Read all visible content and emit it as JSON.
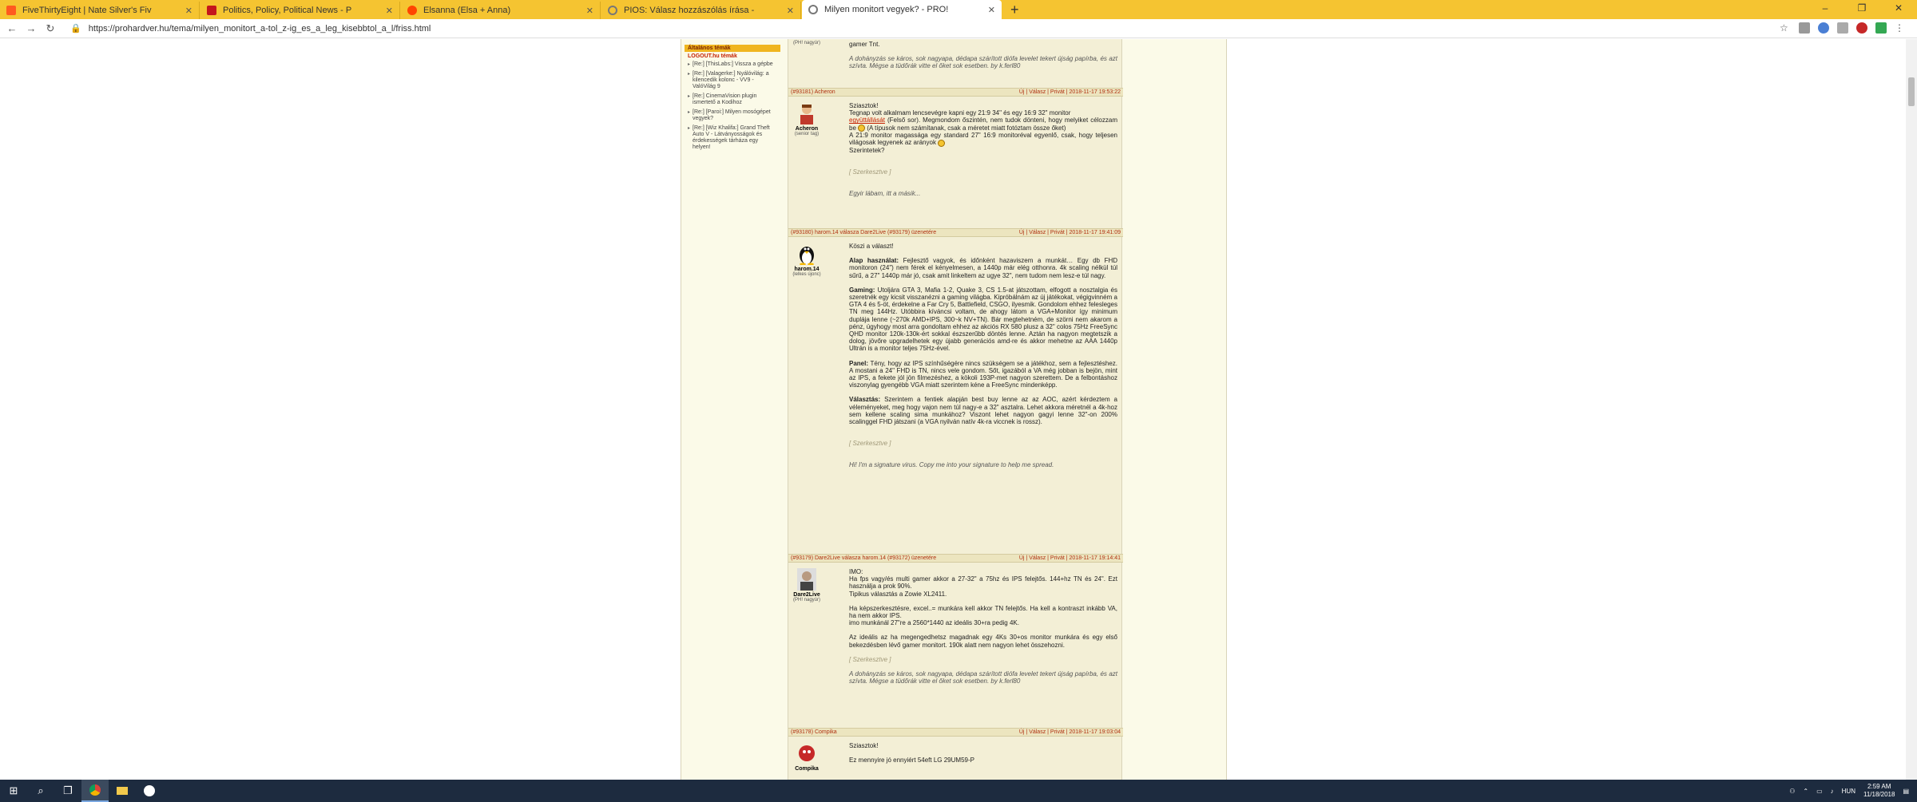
{
  "browser": {
    "tabs": [
      {
        "title": "FiveThirtyEight | Nate Silver's Fiv",
        "icon": "fivethirtyeight-icon",
        "color": "#ff5a1f"
      },
      {
        "title": "Politics, Policy, Political News - P",
        "icon": "politico-icon",
        "color": "#c4161c"
      },
      {
        "title": "Elsanna (Elsa + Anna)",
        "icon": "reddit-icon",
        "color": "#ff4500"
      },
      {
        "title": "PIOS: Válasz hozzászólás írása -",
        "icon": "prohardver-icon",
        "color": "#777777"
      },
      {
        "title": "Milyen monitort vegyek? - PRO!",
        "icon": "prohardver-icon",
        "color": "#777777"
      }
    ],
    "new_tab": "+",
    "url": "https://prohardver.hu/tema/milyen_monitort_a-tol_z-ig_es_a_leg_kisebbtol_a_l/friss.html",
    "window_controls": [
      "–",
      "❐",
      "✕"
    ]
  },
  "sidebar": {
    "header1": "Általános témák",
    "header2": "LOGOUT.hu témák",
    "items": [
      "[Re:] [ThisLabs:] Vissza a gépbe",
      "[Re:] [Valagerke:] Nyálóvilág: a kilencedik kolonc - VV9 - ValóVilág 9",
      "[Re:] CinemaVision plugin ismertető a Kodihoz",
      "[Re:] [Paroi:] Milyen mosógépet vegyek?",
      "[Re:] [Wiz Khalifa:] Grand Theft Auto V - Látványosságok és érdekességek tárháza egy helyen!"
    ]
  },
  "top_fragment": {
    "rank": "(PH! nagyúr)",
    "line": "gamer Tnt.",
    "sig": "A dohányzás se káros, sok nagyapa, dédapa szárított diófa levelet tekert újság papírba, és azt szívta. Mégse a tüdőrák vitte el őket sok esetben. by k.ferl80"
  },
  "posts": [
    {
      "id": "#93181",
      "author": "Acheron",
      "reply_to": "",
      "header_text": "(#93181) Acheron",
      "links": "Új | Válasz | Privát | 2018-11-17 19:53:22",
      "rank": "(senior tag)",
      "lines": [
        "Sziasztok!",
        "Tegnap volt alkalmam lencsevégre kapni egy 21:9 34\" és egy 16:9 32\" monitor",
        "együttállását (Felső sor). Megmondom őszintén, nem tudok dönteni, hogy melyiket célozzam be (A típusok nem számítanak, csak a méretet miatt fotóztam össze őket)",
        "A 21:9 monitor magassága egy standard 27\" 16:9 monitoréval egyenlő, csak, hogy teljesen világosak legyenek az arányok",
        "Szerintetek?"
      ],
      "edit": "[ Szerkesztve ]",
      "sig": "Egyir lábam, itt a másik..."
    },
    {
      "id": "#93180",
      "author": "harom.14",
      "header_text": "(#93180) harom.14 válasza Dare2Live (#93179) üzenetére",
      "links": "Új | Válasz | Privát | 2018-11-17 19:41:09",
      "rank": "(lelkes újonc)",
      "greeting": "Köszi a választ!",
      "alap_label": "Alap használat:",
      "alap": "Fejlesztő vagyok, és időnként hazaviszem a munkát… Egy db FHD monitoron (24\") nem férek el kényelmesen, a 1440p már elég otthonra. 4k scaling nélkül túl sűrű, a 27\" 1440p már jó, csak amit linkeltem az ugye 32\", nem tudom nem lesz-e túl nagy.",
      "gaming_label": "Gaming:",
      "gaming": "Utoljára GTA 3, Mafia 1-2, Quake 3, CS 1.5-at játszottam, elfogott a nosztalgia és szeretnék egy kicsit visszanézni a gaming világba. Kipróbálnám az új játékokat, végigvinném a GTA 4 és 5-öt, érdekelne a Far Cry 5, Battlefield, CSGO, ilyesmik. Gondolom ehhez felesleges TN meg 144Hz. Utóbbira kíváncsi voltam, de ahogy látom a VGA+Monitor így minimum duplája lenne (~270k AMD+IPS, 300~k NV+TN). Bár megtehetném, de szörni nem akarom a pénz, úgyhogy most arra gondoltam ehhez az akciós RX 580 plusz a 32\" colos 75Hz FreeSync QHD monitor 120k-130k-ért sokkal észszerűbb döntés lenne. Aztán ha nagyon megtetszik a dolog, jövőre upgradelhetek egy újabb generációs amd-re és akkor mehetne az AAA 1440p Ultrán is a monitor teljes 75Hz-ével.",
      "panel_label": "Panel:",
      "panel": "Tény, hogy az IPS színhűségére nincs szükségem se a játékhoz, sem a fejlesztéshez. A mostani a 24\" FHD is TN, nincs vele gondom. Sőt, igazából a VA még jobban is bejön, mint az IPS, a fekete jól jön filmezéshez, a kökoli 193P-met nagyon szerettem. De a felbontáshoz viszonylag gyengébb VGA miatt szerintem kéne a FreeSync mindenképp.",
      "valasztas_label": "Választás:",
      "valasztas": "Szerintem a fentiek alapján best buy lenne az az AOC, azért kérdeztem a véleményeket, meg hogy vajon nem túl nagy-e a 32\" asztalra. Lehet akkora méretnél a 4k-hoz sem kellene scaling sima munkához? Viszont lehet nagyon gagyi lenne 32\"-on 200% scalinggel FHD játszani (a VGA nyilván natív 4k-ra viccnek is rossz).",
      "edit": "[ Szerkesztve ]",
      "sig": "Hi! I'm a signature virus. Copy me into your signature to help me spread."
    },
    {
      "id": "#93179",
      "author": "Dare2Live",
      "header_text": "(#93179) Dare2Live válasza harom.14 (#93172) üzenetére",
      "links": "Új | Válasz | Privát | 2018-11-17 19:14:41",
      "rank": "(PH! nagyúr)",
      "lines": [
        "IMO:",
        "Ha fps vagy/és multi gamer akkor a 27-32\" a 75hz és IPS felejtős. 144+hz TN és 24\". Ezt használja a prok 90%.",
        "Tipikus választás a Zowie XL2411."
      ],
      "lines2": [
        "Ha képszerkesztésre, excel..= munkára kell akkor TN felejtős. Ha kell a kontraszt inkább VA, ha nem akkor IPS.",
        "imo munkánál 27\"re a 2560*1440 az ideális 30+ra pedig 4K."
      ],
      "lines3": [
        "Az ideális az ha megengedhetsz magadnak egy 4Ks 30+os monitor munkára és egy első bekezdésben lévő gamer monitort. 190k alatt nem nagyon lehet összehozni."
      ],
      "edit": "[ Szerkesztve ]",
      "sig": "A dohányzás se káros, sok nagyapa, dédapa szárított diófa levelet tekert újság papírba, és azt szívta. Mégse a tüdőrák vitte el őket sok esetben. by k.ferl80"
    },
    {
      "id": "#93178",
      "author": "Compika",
      "header_text": "(#93178) Compika",
      "links": "Új | Válasz | Privát | 2018-11-17 19:03:04",
      "lines": [
        "Sziasztok!"
      ],
      "lines2": [
        "Ez mennyire jó ennyiért 54eft LG 29UM59-P"
      ]
    }
  ],
  "taskbar": {
    "lang": "HUN",
    "time": "2:59 AM",
    "date": "11/18/2018"
  }
}
